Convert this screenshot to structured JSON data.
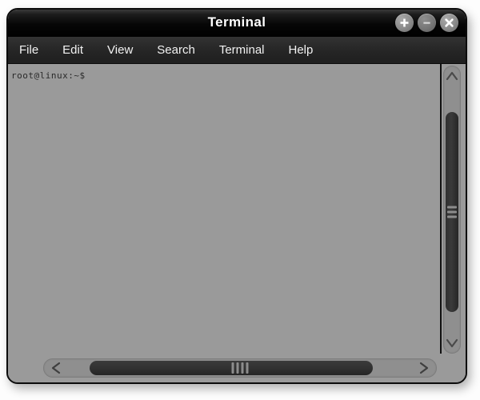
{
  "window": {
    "title": "Terminal",
    "buttons": [
      {
        "name": "maximize-button",
        "icon": "plus-icon",
        "glyph": "+"
      },
      {
        "name": "minimize-button",
        "icon": "minus-icon",
        "glyph": "−"
      },
      {
        "name": "close-button",
        "icon": "close-icon",
        "glyph": "✕"
      }
    ]
  },
  "menubar": {
    "items": [
      {
        "label": "File"
      },
      {
        "label": "Edit"
      },
      {
        "label": "View"
      },
      {
        "label": "Search"
      },
      {
        "label": "Terminal"
      },
      {
        "label": "Help"
      }
    ]
  },
  "terminal": {
    "prompt": "root@linux:~$",
    "background_color": "#9a9a9a",
    "text_color": "#2a2a2a"
  },
  "scrollbars": {
    "vertical": {
      "up_arrow": "∧",
      "down_arrow": "∨"
    },
    "horizontal": {
      "left_arrow": "<",
      "right_arrow": ">"
    }
  }
}
